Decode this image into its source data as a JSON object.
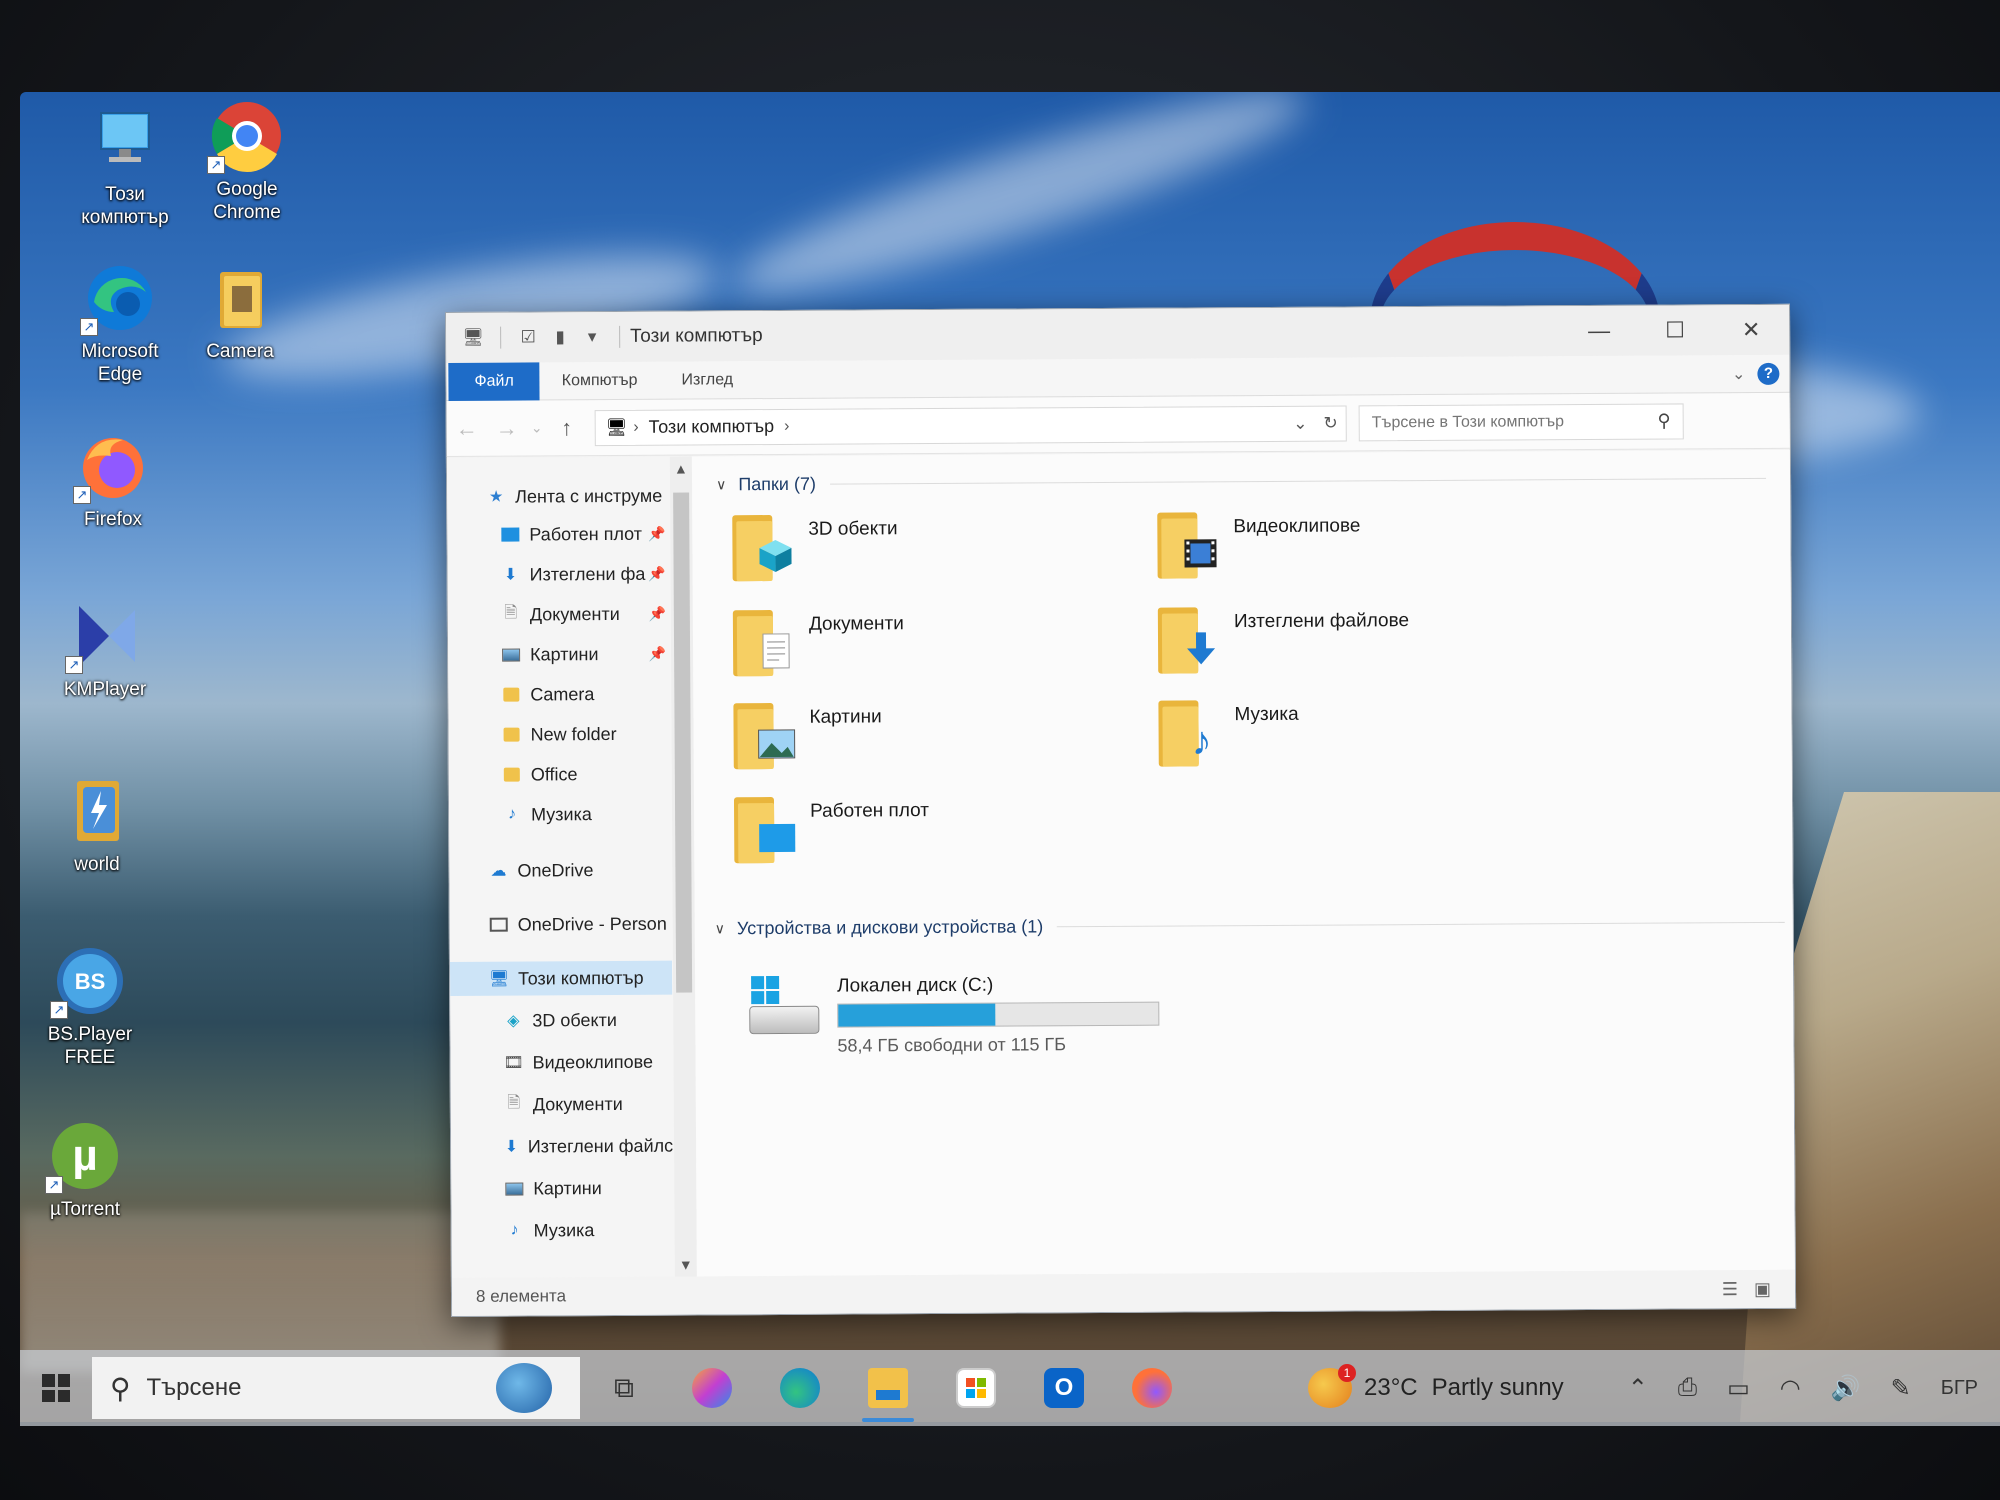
{
  "desktop": {
    "icons": [
      {
        "label": "Този компютър",
        "icon": "computer-icon"
      },
      {
        "label": "Google Chrome",
        "icon": "chrome-icon"
      },
      {
        "label": "Microsoft Edge",
        "icon": "edge-icon"
      },
      {
        "label": "Camera",
        "icon": "folder-icon"
      },
      {
        "label": "Firefox",
        "icon": "firefox-icon"
      },
      {
        "label": "KMPlayer",
        "icon": "kmplayer-icon"
      },
      {
        "label": "world",
        "icon": "winrar-icon"
      },
      {
        "label": "BS.Player FREE",
        "icon": "bsplayer-icon"
      },
      {
        "label": "µTorrent",
        "icon": "utorrent-icon"
      }
    ]
  },
  "explorer": {
    "title": "Този компютър",
    "window_buttons": {
      "minimize": "—",
      "maximize": "☐",
      "close": "✕"
    },
    "ribbon": {
      "file": "Файл",
      "computer": "Компютър",
      "view": "Изглед"
    },
    "address": {
      "root_crumb": "Този компютър"
    },
    "search": {
      "placeholder": "Търсене в Този компютър"
    },
    "nav": {
      "quick_access": "Лента с инструме",
      "items": [
        {
          "label": "Работен плот",
          "pinned": true
        },
        {
          "label": "Изтеглени фа",
          "pinned": true
        },
        {
          "label": "Документи",
          "pinned": true
        },
        {
          "label": "Картини",
          "pinned": true
        },
        {
          "label": "Camera",
          "pinned": false
        },
        {
          "label": "New folder",
          "pinned": false
        },
        {
          "label": "Office",
          "pinned": false
        },
        {
          "label": "Музика",
          "pinned": false
        }
      ],
      "onedrive": "OneDrive",
      "onedrive_personal": "OneDrive - Person",
      "this_pc": "Този компютър",
      "this_pc_children": [
        "3D обекти",
        "Видеоклипове",
        "Документи",
        "Изтеглени файлс",
        "Картини",
        "Музика"
      ]
    },
    "folders_group": "Папки (7)",
    "folders": [
      {
        "name": "3D обекти",
        "overlay": "3d-cube-icon"
      },
      {
        "name": "Видеоклипове",
        "overlay": "film-icon"
      },
      {
        "name": "Документи",
        "overlay": "document-icon"
      },
      {
        "name": "Изтеглени файлове",
        "overlay": "download-arrow-icon"
      },
      {
        "name": "Картини",
        "overlay": "picture-icon"
      },
      {
        "name": "Музика",
        "overlay": "music-note-icon"
      },
      {
        "name": "Работен плот",
        "overlay": "desktop-icon"
      }
    ],
    "devices_group": "Устройства и дискови устройства (1)",
    "drive": {
      "name": "Локален диск (C:)",
      "free_text": "58,4 ГБ свободни от 115 ГБ",
      "used_fraction": 0.49
    },
    "status": "8 елемента"
  },
  "taskbar": {
    "search_text": "Търсене",
    "weather": {
      "temp": "23°C",
      "condition": "Partly sunny",
      "badge": "1"
    },
    "language": "БГР"
  }
}
